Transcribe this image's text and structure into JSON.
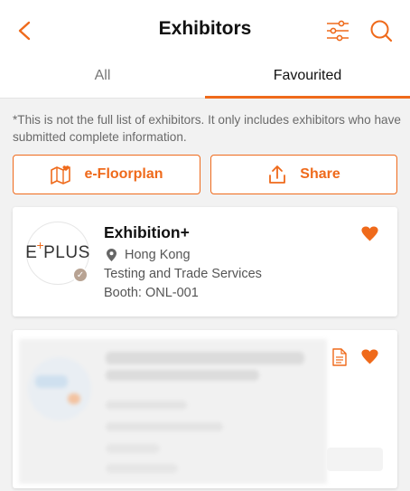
{
  "header": {
    "title": "Exhibitors",
    "icons": [
      "chevron-left-icon",
      "filter-sliders-icon",
      "search-icon"
    ]
  },
  "tabs": [
    {
      "label": "All",
      "active": false
    },
    {
      "label": "Favourited",
      "active": true
    }
  ],
  "notice": "*This is not the full list of exhibitors. It only includes exhibitors who have submitted complete information.",
  "actions": {
    "floorplan_label": "e-Floorplan",
    "share_label": "Share"
  },
  "exhibitors": [
    {
      "logo_text_left": "E",
      "logo_text_right": "PLUS",
      "logo_plus": "+",
      "name": "Exhibition+",
      "location": "Hong Kong",
      "category": "Testing and Trade Services",
      "booth": "Booth:  ONL-001",
      "favourited": true
    }
  ],
  "colors": {
    "accent": "#ef6a1b",
    "background": "#f2f2f2",
    "muted_text": "#6a6a6a"
  }
}
